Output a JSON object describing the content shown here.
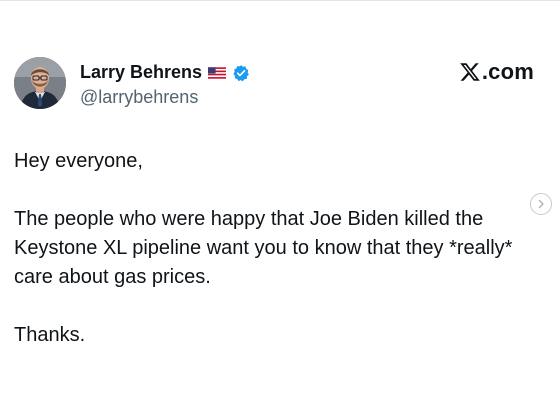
{
  "author": {
    "display_name": "Larry Behrens",
    "handle": "@larrybehrens",
    "flag_icon": "us-flag-icon",
    "verified_icon": "verified-badge-icon",
    "verified_color": "#1d9bf0"
  },
  "brand": {
    "logo_icon": "x-logo-icon",
    "suffix": ".com"
  },
  "tweet": {
    "paragraphs": [
      "Hey everyone,",
      "The people who were happy that Joe Biden killed the Keystone XL pipeline want you to know that they *really* care about gas prices.",
      "Thanks."
    ]
  },
  "navigation": {
    "next_icon": "chevron-right-icon"
  },
  "colors": {
    "text": "#0f1419",
    "secondary_text": "#536471",
    "background": "#ffffff"
  }
}
